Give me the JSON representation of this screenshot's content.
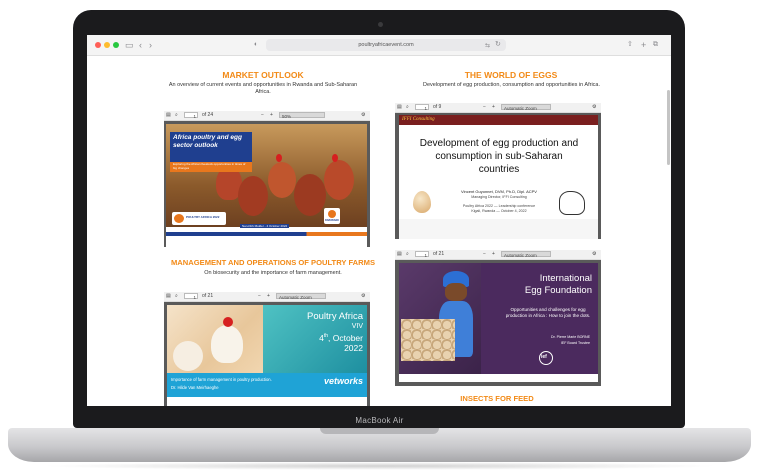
{
  "device": {
    "label": "MacBook Air"
  },
  "browser": {
    "url": "poultryafricaevent.com",
    "colors": {
      "close": "#ff5f57",
      "minimize": "#febc2e",
      "zoom": "#28c840"
    }
  },
  "sections": {
    "market": {
      "title": "MARKET OUTLOOK",
      "subtitle": "An overview of current events and opportunities in Rwanda and Sub-Saharan Africa.",
      "pdf": {
        "page": "1",
        "of": "of 24",
        "zoom": "50%",
        "slide_title": "Africa poultry and egg sector outlook",
        "slide_sub": "Exploring the African livestock opportunities in times of big changes",
        "logo_text": "POULTRY AFRICA 2022",
        "author": "Nan-Dirk Mulder - 4 October 2022",
        "brand": "RABOBANK"
      }
    },
    "eggs": {
      "title": "THE WORLD OF EGGS",
      "subtitle": "Development of egg production, consumption and opportunities in Africa.",
      "pdf": {
        "page": "1",
        "of": "of 9",
        "zoom": "Automatic Zoom",
        "header_brand": "IFFI Consulting",
        "slide_title": "Development of egg production and consumption in sub-Saharan countries",
        "presenter": "Vincent Guyonnet, DVM, Ph.D, Dipl. ACPV",
        "role": "Managing Director, IFFI Consulting",
        "event": "Poultry Africa 2022 — Leadership conference",
        "location": "Kigali, Rwanda — October 4, 2022"
      }
    },
    "management": {
      "title": "MANAGEMENT AND OPERATIONS OF POULTRY FARMS",
      "subtitle": "On biosecurity and the importance of farm management.",
      "pdf": {
        "page": "1",
        "of": "of 21",
        "zoom": "Automatic Zoom",
        "event": "Poultry Africa",
        "venue": "VIV",
        "date_day": "4",
        "date_sup": "th",
        "date_month": ", October",
        "date_year": "2022",
        "caption": "Importance of farm management in poultry production.",
        "author": "Dr. Hilde Van Meirhaeghe",
        "brand": "vetworks"
      }
    },
    "ief": {
      "pdf": {
        "page": "1",
        "of": "of 21",
        "zoom": "Automatic Zoom",
        "title_line1": "International",
        "title_line2": "Egg Foundation",
        "tagline": "Opportunities and challenges for egg production in Africa : How to join the dots.",
        "speaker": "Dr. Pierre Marie BORNE",
        "speaker_role": "IEF Board Trustee",
        "logo": "ief"
      }
    },
    "insects": {
      "title": "INSECTS FOR FEED"
    }
  }
}
